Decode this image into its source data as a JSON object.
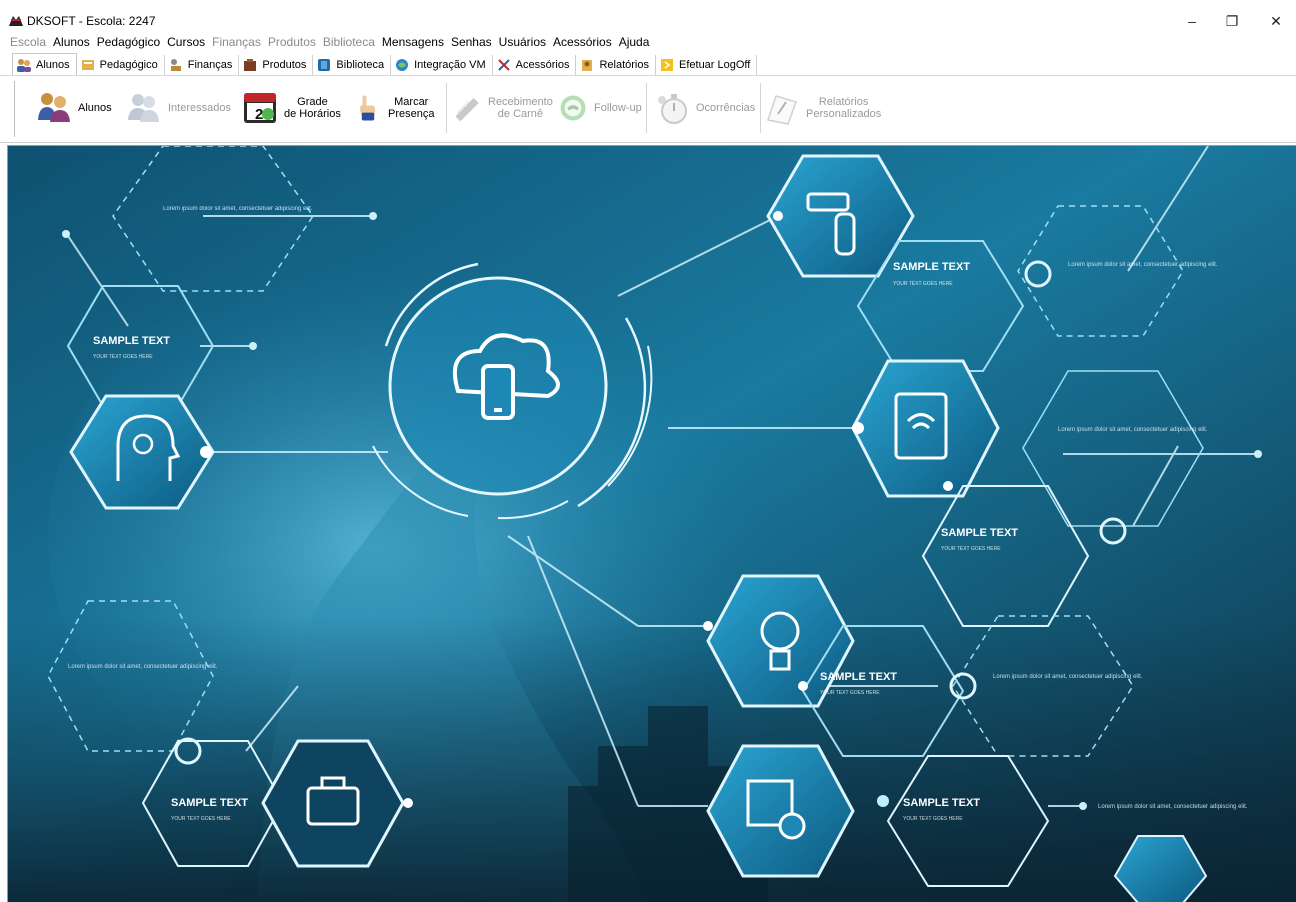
{
  "window": {
    "title": "DKSOFT - Escola: 2247",
    "controls": [
      "–",
      "❐",
      "✕"
    ]
  },
  "menu": [
    {
      "label": "Escola",
      "enabled": false
    },
    {
      "label": "Alunos",
      "enabled": true
    },
    {
      "label": "Pedagógico",
      "enabled": true
    },
    {
      "label": "Cursos",
      "enabled": true
    },
    {
      "label": "Finanças",
      "enabled": false
    },
    {
      "label": "Produtos",
      "enabled": false
    },
    {
      "label": "Biblioteca",
      "enabled": false
    },
    {
      "label": "Mensagens",
      "enabled": true
    },
    {
      "label": "Senhas",
      "enabled": true
    },
    {
      "label": "Usuários",
      "enabled": true
    },
    {
      "label": "Acessórios",
      "enabled": true
    },
    {
      "label": "Ajuda",
      "enabled": true
    }
  ],
  "tabs": [
    {
      "label": "Alunos",
      "icon": "students-icon",
      "active": true
    },
    {
      "label": "Pedagógico",
      "icon": "pedagogic-icon",
      "active": false
    },
    {
      "label": "Finanças",
      "icon": "finance-icon",
      "active": false
    },
    {
      "label": "Produtos",
      "icon": "products-icon",
      "active": false
    },
    {
      "label": "Biblioteca",
      "icon": "library-icon",
      "active": false
    },
    {
      "label": "Integração VM",
      "icon": "integration-icon",
      "active": false
    },
    {
      "label": "Acessórios",
      "icon": "accessories-icon",
      "active": false
    },
    {
      "label": "Relatórios",
      "icon": "reports-icon",
      "active": false
    },
    {
      "label": "Efetuar LogOff",
      "icon": "logoff-icon",
      "active": false
    }
  ],
  "ribbon": [
    {
      "label": "Alunos",
      "icon": "students-icon",
      "enabled": true
    },
    {
      "label": "Interessados",
      "icon": "interested-icon",
      "enabled": false
    },
    {
      "label": "Grade\nde Horários",
      "icon": "calendar-icon",
      "enabled": true,
      "calendar_day": "20"
    },
    {
      "label": "Marcar\nPresença",
      "icon": "hand-pointer-icon",
      "enabled": true
    },
    {
      "label": "Recebimento\nde Carnê",
      "icon": "receipt-icon",
      "enabled": false
    },
    {
      "label": "Follow-up",
      "icon": "phone-icon",
      "enabled": false
    },
    {
      "label": "Ocorrências",
      "icon": "stopwatch-icon",
      "enabled": false
    },
    {
      "label": "Relatórios\nPersonalizados",
      "icon": "report-pen-icon",
      "enabled": false
    }
  ],
  "banner": {
    "sample_text": "SAMPLE TEXT",
    "sample_sub": "YOUR TEXT GOES HERE",
    "lorem_short": "Lorem ipsum dolor sit amet, consectetuer adipiscing elit.",
    "colors": {
      "deep": "#0d3b52",
      "mid": "#1a7aa0",
      "light": "#46c1e6",
      "glow": "#bfefff"
    }
  }
}
